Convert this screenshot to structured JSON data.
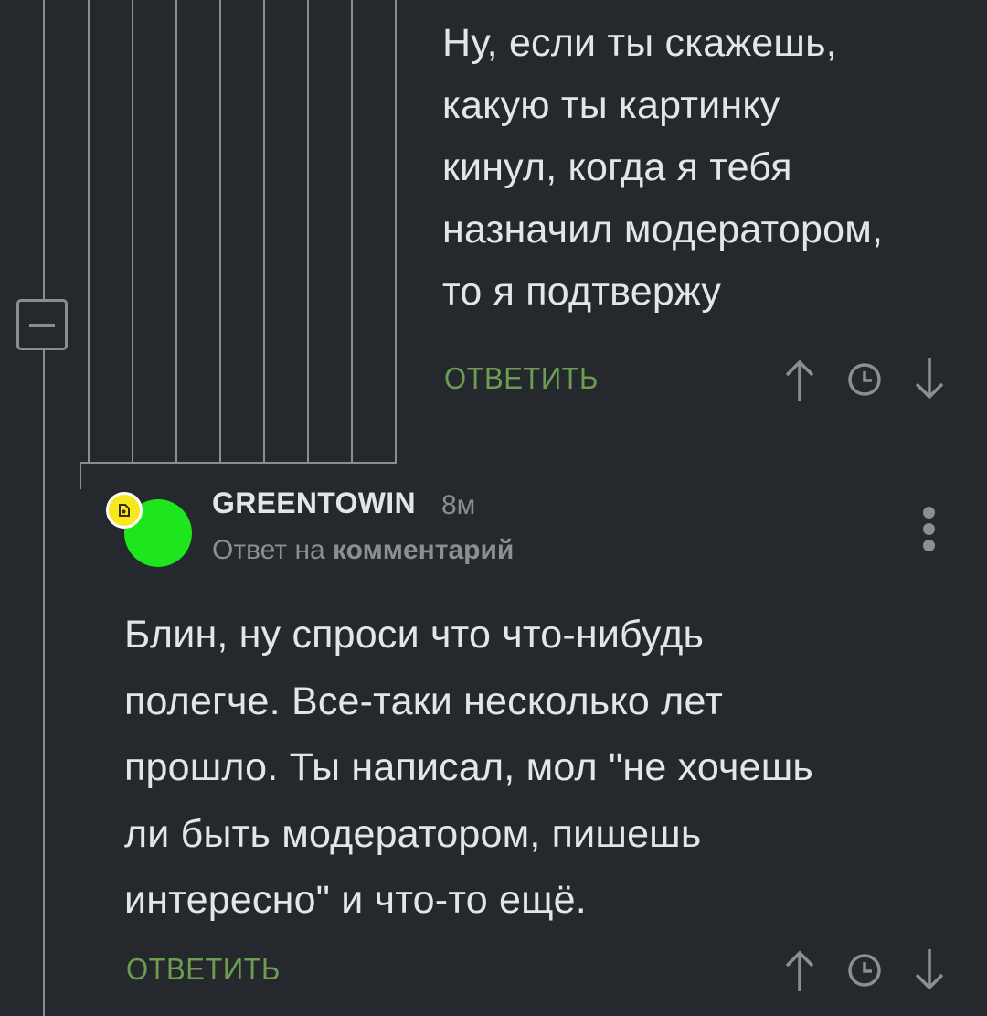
{
  "comment_top": {
    "lines": [
      "Ну, если ты скажешь,",
      "какую ты картинку",
      "кинул, когда я тебя",
      "назначил модератором,",
      "то я подтвержу"
    ],
    "reply_label": "ОТВЕТИТЬ"
  },
  "comment_main": {
    "username": "GREENTOWIN",
    "time": "8м",
    "reply_to_prefix": "Ответ на",
    "reply_to_link": "комментарий",
    "lines": [
      "Блин, ну спроси что что-нибудь",
      "полегче. Все-таки несколько лет",
      "прошло. Ты написал, мол \"не хочешь",
      "ли быть модератором, пишешь",
      "интересно\" и что-то ещё."
    ],
    "reply_label": "ОТВЕТИТЬ"
  },
  "icons": {
    "up": "arrow-up-icon",
    "time": "clock-icon",
    "down": "arrow-down-icon",
    "more": "more-vertical-icon",
    "collapse": "collapse-minus-icon"
  },
  "colors": {
    "background": "#25282c",
    "text": "#e4e5e6",
    "muted": "#8b8e92",
    "reply": "#6d9c52",
    "avatar": "#1ee61c",
    "badge": "#f6e71f"
  }
}
